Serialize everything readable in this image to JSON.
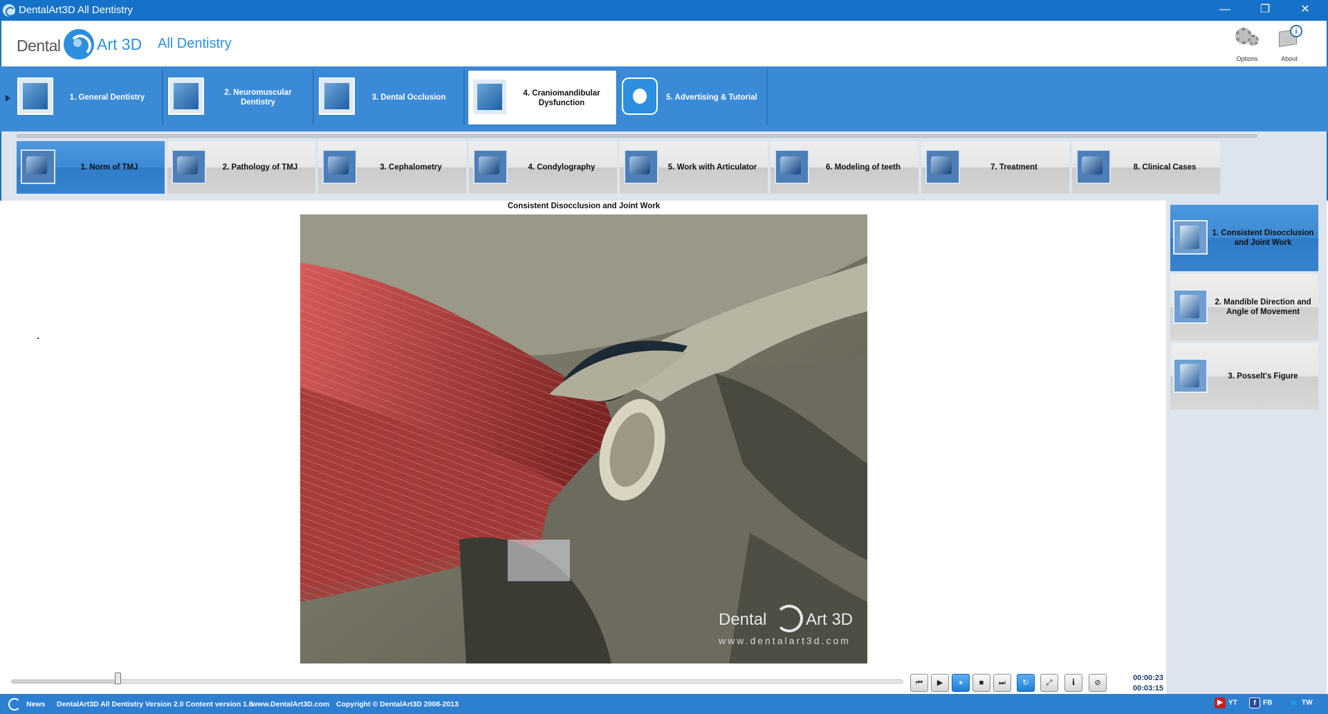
{
  "window": {
    "title": "DentalArt3D All Dentistry",
    "minimize_glyph": "—",
    "maximize_glyph": "❐",
    "close_glyph": "✕"
  },
  "header": {
    "logo_left": "Dental",
    "logo_right": "Art 3D",
    "product": "All Dentistry",
    "options_label": "Options",
    "about_label": "About"
  },
  "categories": [
    {
      "label": "1. General Dentistry"
    },
    {
      "label": "2. Neuromuscular Dentistry"
    },
    {
      "label": "3. Dental Occlusion"
    },
    {
      "label": "4. Craniomandibular Dysfunction"
    },
    {
      "label": "5. Advertising & Tutorial"
    }
  ],
  "active_category": 3,
  "subcategories": [
    {
      "label": "1. Norm of TMJ"
    },
    {
      "label": "2. Pathology of TMJ"
    },
    {
      "label": "3. Cephalometry"
    },
    {
      "label": "4. Condylography"
    },
    {
      "label": "5. Work with Articulator"
    },
    {
      "label": "6. Modeling of teeth"
    },
    {
      "label": "7. Treatment"
    },
    {
      "label": "8. Clinical Cases"
    }
  ],
  "active_subcategory": 0,
  "video": {
    "title": "Consistent Disocclusion and Joint Work",
    "watermark_left": "Dental",
    "watermark_right": "Art 3D",
    "watermark_url": "www.dentalart3d.com"
  },
  "lessons": [
    {
      "label": "1. Consistent Disocclusion and Joint Work"
    },
    {
      "label": "2. Mandible Direction and Angle of Movement"
    },
    {
      "label": "3. Posselt's Figure"
    }
  ],
  "active_lesson": 0,
  "player": {
    "elapsed": "00:00:23",
    "total": "00:03:15",
    "progress_fraction": 0.118,
    "buttons": {
      "rewind": "⏮",
      "play": "▶",
      "pause": "⏸",
      "stop": "■",
      "forward": "⏭",
      "loop": "↻",
      "fullscreen": "⤢",
      "info": "i",
      "subtitles": "⊘"
    }
  },
  "statusbar": {
    "news": "News",
    "version": "DentalArt3D All Dentistry Version 2.0 Content version 1.6",
    "website": "www.DentalArt3D.com",
    "copyright": "Copyright © DentalArt3D 2008-2013",
    "yt": "YT",
    "fb": "FB",
    "tw": "TW",
    "yt_icon": "▶",
    "fb_icon": "f",
    "tw_icon": "✶"
  }
}
